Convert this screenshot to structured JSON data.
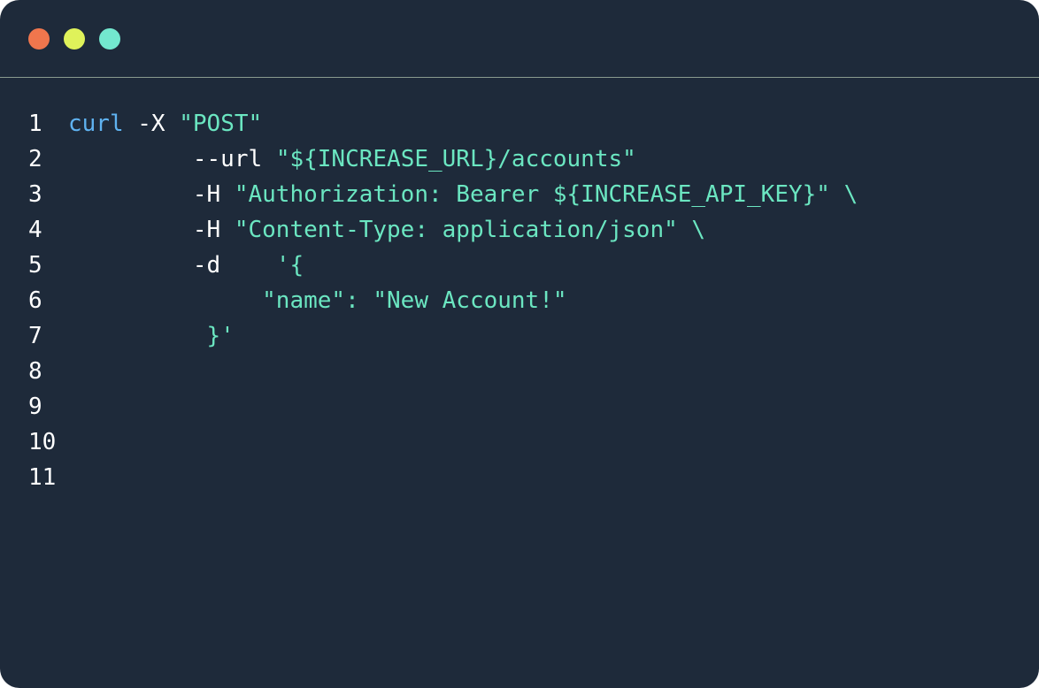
{
  "window": {
    "controls": [
      {
        "name": "close",
        "color": "#f0764d"
      },
      {
        "name": "minimize",
        "color": "#dff25a"
      },
      {
        "name": "maximize",
        "color": "#73e8cf"
      }
    ]
  },
  "colors": {
    "background": "#1e2a3a",
    "command": "#5fb2f0",
    "plain": "#ffffff",
    "string": "#6be6c1",
    "divider": "#8a9a8e"
  },
  "code": {
    "lines": [
      {
        "number": "1",
        "tokens": [
          {
            "text": "curl",
            "kind": "cmd"
          },
          {
            "text": " -X ",
            "kind": "plain"
          },
          {
            "text": "\"POST\"",
            "kind": "str"
          }
        ]
      },
      {
        "number": "2",
        "tokens": [
          {
            "text": "         --url ",
            "kind": "plain"
          },
          {
            "text": "\"${INCREASE_URL}/accounts\"",
            "kind": "str"
          }
        ]
      },
      {
        "number": "3",
        "tokens": [
          {
            "text": "         -H ",
            "kind": "plain"
          },
          {
            "text": "\"Authorization: Bearer ${INCREASE_API_KEY}\" \\",
            "kind": "str"
          }
        ]
      },
      {
        "number": "4",
        "tokens": [
          {
            "text": "         -H ",
            "kind": "plain"
          },
          {
            "text": "\"Content-Type: application/json\" \\",
            "kind": "str"
          }
        ]
      },
      {
        "number": "5",
        "tokens": [
          {
            "text": "         -d    ",
            "kind": "plain"
          },
          {
            "text": "'{",
            "kind": "str"
          }
        ]
      },
      {
        "number": "6",
        "tokens": [
          {
            "text": "              \"name\": \"New Account!\"",
            "kind": "str"
          }
        ]
      },
      {
        "number": "7",
        "tokens": [
          {
            "text": "          }'",
            "kind": "str"
          }
        ]
      },
      {
        "number": "8",
        "tokens": []
      },
      {
        "number": "9",
        "tokens": []
      },
      {
        "number": "10",
        "tokens": []
      },
      {
        "number": "11",
        "tokens": []
      }
    ]
  }
}
